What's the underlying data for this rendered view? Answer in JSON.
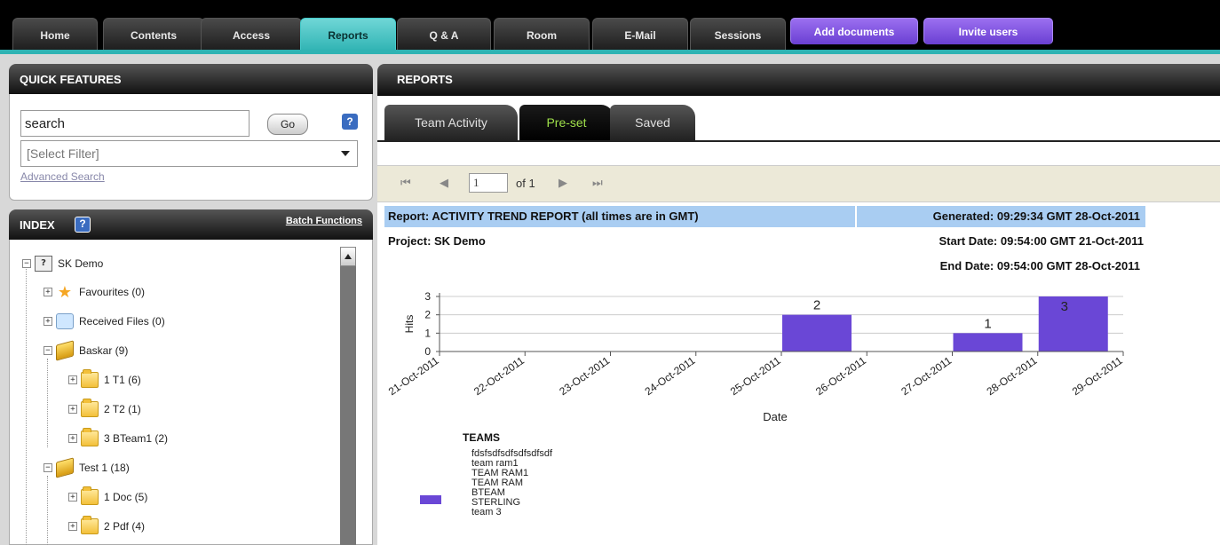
{
  "nav": {
    "tabs": [
      {
        "label": "Home"
      },
      {
        "label": "Contents"
      },
      {
        "label": "Access"
      },
      {
        "label": "Reports"
      },
      {
        "label": "Q & A"
      },
      {
        "label": "Room"
      },
      {
        "label": "E-Mail"
      },
      {
        "label": "Sessions"
      }
    ],
    "actions": [
      {
        "label": "Add documents"
      },
      {
        "label": "Invite users"
      }
    ],
    "active_tab": "Reports"
  },
  "quick_features": {
    "title": "QUICK FEATURES",
    "search_value": "search",
    "go_label": "Go",
    "help": "?",
    "filter_selected": "[Select Filter]",
    "advanced_search": "Advanced Search"
  },
  "index": {
    "title": "INDEX",
    "help": "?",
    "batch": "Batch Functions",
    "items": [
      {
        "label": "SK Demo"
      },
      {
        "label": "Favourites (0)"
      },
      {
        "label": "Received Files (0)"
      },
      {
        "label": "Baskar (9)"
      },
      {
        "label": "1 T1 (6)"
      },
      {
        "label": "2 T2 (1)"
      },
      {
        "label": "3 BTeam1 (2)"
      },
      {
        "label": "Test 1 (18)"
      },
      {
        "label": "1 Doc (5)"
      },
      {
        "label": "2 Pdf (4)"
      }
    ]
  },
  "reports": {
    "title": "REPORTS",
    "tabs": [
      {
        "label": "Team Activity"
      },
      {
        "label": "Pre-set"
      },
      {
        "label": "Saved"
      }
    ],
    "pager": {
      "first": "⏮",
      "prev": "◀",
      "page": "1",
      "of": "of 1",
      "next": "▶",
      "last": "⏭"
    },
    "report_title": "Report: ACTIVITY TREND REPORT (all times are in GMT)",
    "generated": "Generated: 09:29:34 GMT 28-Oct-2011",
    "project": "Project: SK Demo",
    "start_date": "Start Date: 09:54:00 GMT 21-Oct-2011",
    "end_date": "End Date: 09:54:00 GMT 28-Oct-2011",
    "legend_title": "TEAMS",
    "legend_items": [
      "fdsfsdfsdfsdfsdfsdf",
      "team ram1",
      "TEAM RAM1",
      "TEAM RAM",
      "BTEAM",
      "STERLING",
      "team 3"
    ]
  },
  "colors": {
    "accent": "#2fb3b3",
    "bar": "#6a47d6",
    "header_blue": "#a9cdf2",
    "preset_green": "#9fe04a"
  },
  "chart_data": {
    "type": "bar",
    "categories": [
      "21-Oct-2011",
      "22-Oct-2011",
      "23-Oct-2011",
      "24-Oct-2011",
      "25-Oct-2011",
      "26-Oct-2011",
      "27-Oct-2011",
      "28-Oct-2011",
      "29-Oct-2011"
    ],
    "values": [
      0,
      0,
      0,
      0,
      2,
      0,
      1,
      3,
      0
    ],
    "data_labels": [
      "",
      "",
      "",
      "",
      "2",
      "",
      "1",
      "3",
      ""
    ],
    "xlabel": "Date",
    "ylabel": "Hits",
    "ylim": [
      0,
      3
    ],
    "yticks": [
      "0",
      "1",
      "2",
      "3"
    ],
    "grid": true
  }
}
